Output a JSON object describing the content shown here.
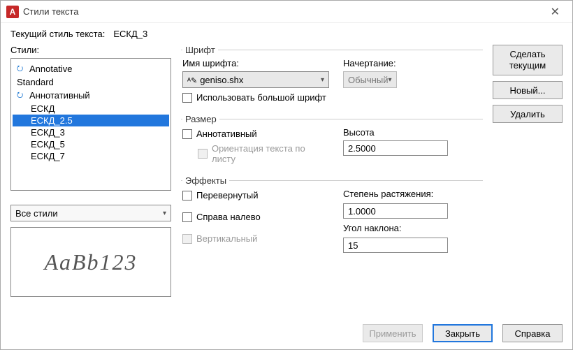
{
  "window": {
    "title": "Стили текста"
  },
  "current": {
    "label": "Текущий стиль текста:",
    "value": "ЕСКД_3"
  },
  "stylesLabel": "Стили:",
  "styles": [
    {
      "name": "Annotative",
      "annotative": true,
      "indent": false,
      "selected": false
    },
    {
      "name": "Standard",
      "annotative": false,
      "indent": false,
      "selected": false
    },
    {
      "name": "Аннотативный",
      "annotative": true,
      "indent": false,
      "selected": false
    },
    {
      "name": "ЕСКД",
      "annotative": false,
      "indent": true,
      "selected": false
    },
    {
      "name": "ЕСКД_2.5",
      "annotative": false,
      "indent": true,
      "selected": true
    },
    {
      "name": "ЕСКД_3",
      "annotative": false,
      "indent": true,
      "selected": false
    },
    {
      "name": "ЕСКД_5",
      "annotative": false,
      "indent": true,
      "selected": false
    },
    {
      "name": "ЕСКД_7",
      "annotative": false,
      "indent": true,
      "selected": false
    }
  ],
  "filter": "Все стили",
  "previewText": "AaBb123",
  "font": {
    "legend": "Шрифт",
    "nameLabel": "Имя шрифта:",
    "nameValue": "geniso.shx",
    "styleLabel": "Начертание:",
    "styleValue": "Обычный",
    "bigFontLabel": "Использовать большой шрифт"
  },
  "size": {
    "legend": "Размер",
    "annotativeLabel": "Аннотативный",
    "orientationLabel": "Ориентация текста по листу",
    "heightLabel": "Высота",
    "heightValue": "2.5000"
  },
  "effects": {
    "legend": "Эффекты",
    "upsideDownLabel": "Перевернутый",
    "backwardsLabel": "Справа налево",
    "verticalLabel": "Вертикальный",
    "widthFactorLabel": "Степень растяжения:",
    "widthFactorValue": "1.0000",
    "obliqueLabel": "Угол наклона:",
    "obliqueValue": "15"
  },
  "sideButtons": {
    "setCurrent1": "Сделать",
    "setCurrent2": "текущим",
    "new": "Новый...",
    "delete": "Удалить"
  },
  "footer": {
    "apply": "Применить",
    "close": "Закрыть",
    "help": "Справка"
  }
}
